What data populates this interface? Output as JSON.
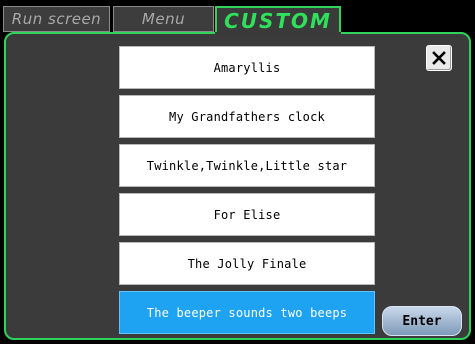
{
  "tabs": [
    {
      "label": "Run screen",
      "active": false
    },
    {
      "label": "Menu",
      "active": false
    },
    {
      "label": "CUSTOM",
      "active": true
    }
  ],
  "songs": [
    {
      "label": "Amaryllis",
      "selected": false
    },
    {
      "label": "My Grandfathers clock",
      "selected": false
    },
    {
      "label": "Twinkle,Twinkle,Little star",
      "selected": false
    },
    {
      "label": "For Elise",
      "selected": false
    },
    {
      "label": "The Jolly Finale",
      "selected": false
    },
    {
      "label": "The beeper sounds two beeps",
      "selected": true
    }
  ],
  "close_icon": "close-icon",
  "enter_label": "Enter",
  "colors": {
    "accent_green": "#2fd35a",
    "selected_blue": "#1ea2f2",
    "panel_bg": "#3b3b3b"
  }
}
